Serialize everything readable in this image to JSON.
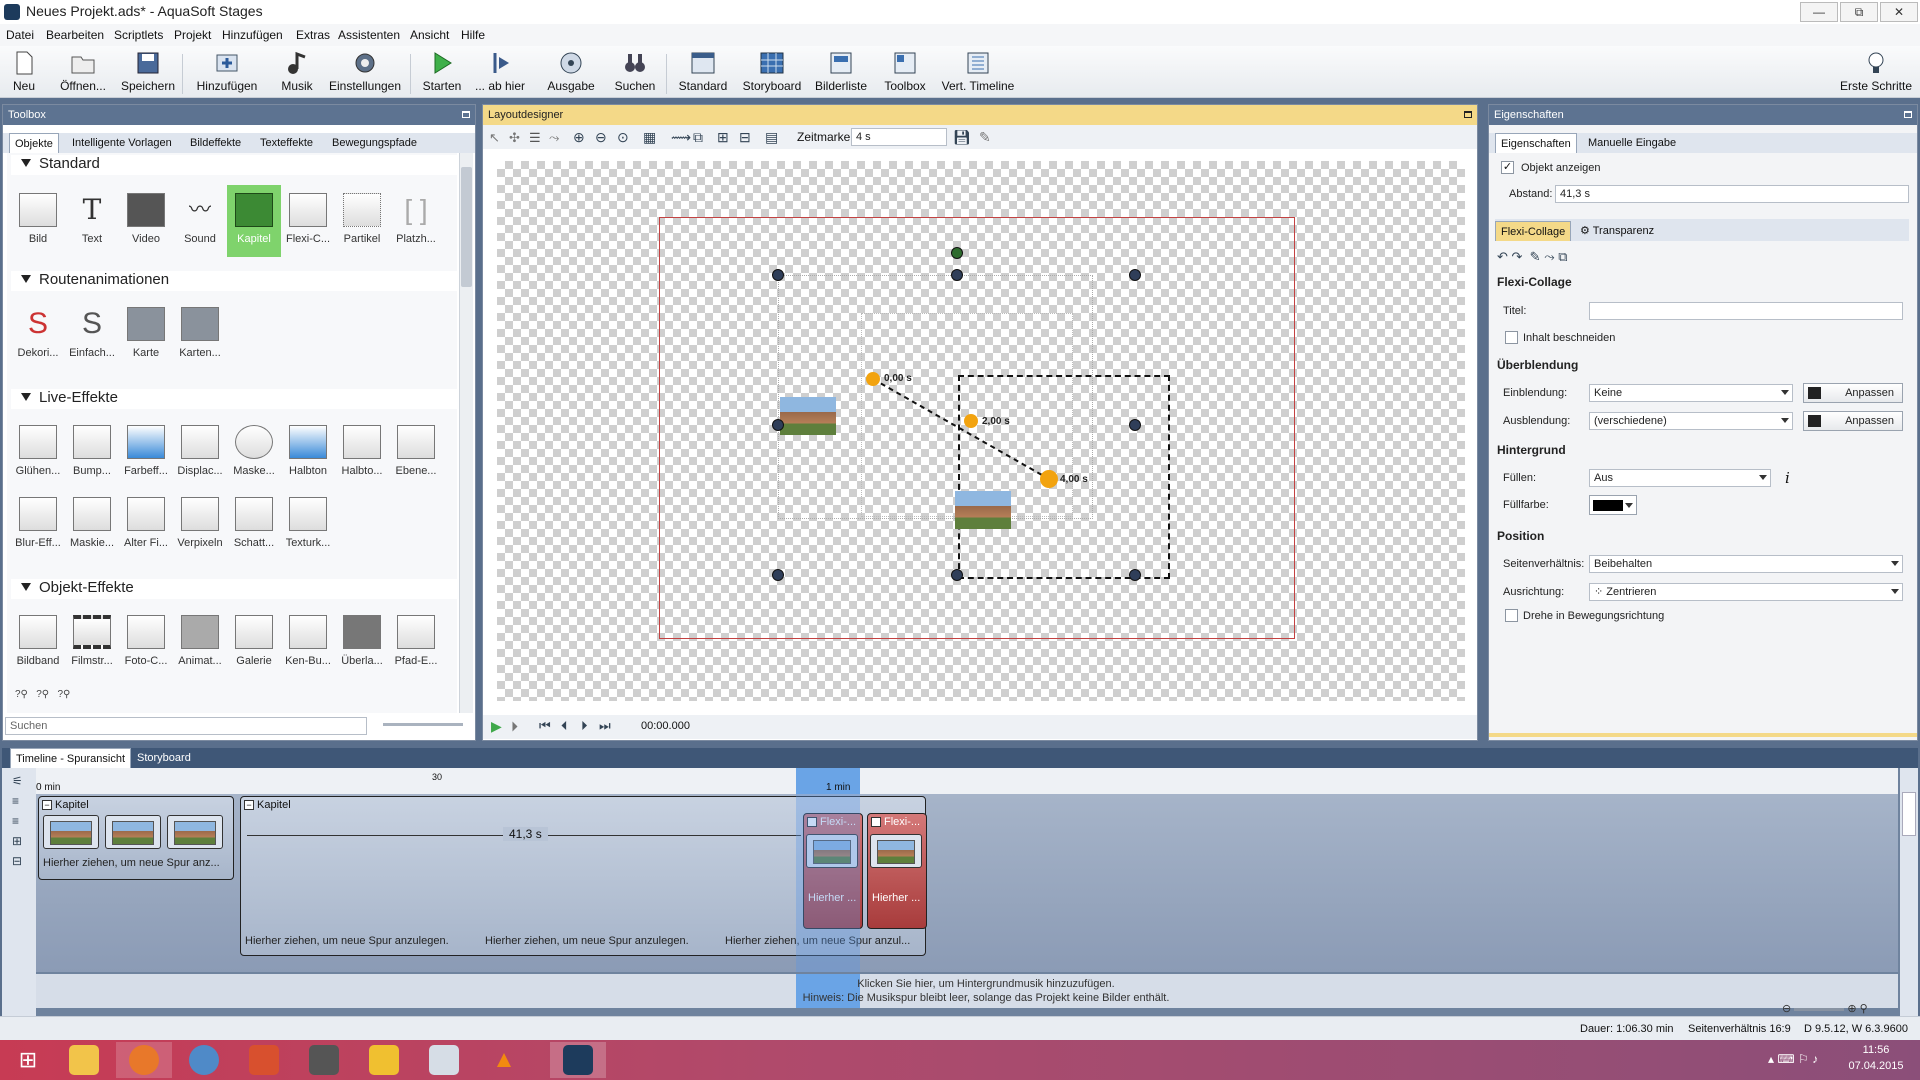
{
  "window": {
    "title": "Neues Projekt.ads* - AquaSoft Stages",
    "min": "—",
    "max": "⧉",
    "close": "✕"
  },
  "menu": [
    "Datei",
    "Bearbeiten",
    "Scriptlets",
    "Projekt",
    "Hinzufügen",
    "Extras",
    "Assistenten",
    "Ansicht",
    "Hilfe"
  ],
  "toolbar": {
    "neu": "Neu",
    "oeffnen": "Öffnen...",
    "speichern": "Speichern",
    "hinzufuegen": "Hinzufügen",
    "musik": "Musik",
    "einstellungen": "Einstellungen",
    "starten": "Starten",
    "abhier": "... ab hier",
    "ausgabe": "Ausgabe",
    "suchen": "Suchen",
    "standard": "Standard",
    "storyboard": "Storyboard",
    "bilderliste": "Bilderliste",
    "toolbox": "Toolbox",
    "verttimeline": "Vert. Timeline",
    "ersteschritte": "Erste Schritte"
  },
  "toolbox": {
    "title": "Toolbox",
    "tabs": [
      "Objekte",
      "Intelligente Vorlagen",
      "Bildeffekte",
      "Texteffekte",
      "Bewegungspfade"
    ],
    "sections": {
      "standard": "Standard",
      "routen": "Routenanimationen",
      "live": "Live-Effekte",
      "objekt": "Objekt-Effekte"
    },
    "standard_items": [
      "Bild",
      "Text",
      "Video",
      "Sound",
      "Kapitel",
      "Flexi-C...",
      "Partikel",
      "Platzh..."
    ],
    "routen_items": [
      "Dekori...",
      "Einfach...",
      "Karte",
      "Karten..."
    ],
    "live_items_row1": [
      "Glühen...",
      "Bump...",
      "Farbeff...",
      "Displac...",
      "Maske...",
      "Halbton",
      "Halbto...",
      "Ebene..."
    ],
    "live_items_row2": [
      "Blur-Eff...",
      "Maskie...",
      "Alter Fi...",
      "Verpixeln",
      "Schatt...",
      "Texturk..."
    ],
    "objekt_items": [
      "Bildband",
      "Filmstr...",
      "Foto-C...",
      "Animat...",
      "Galerie",
      "Ken-Bu...",
      "Überla...",
      "Pfad-E..."
    ],
    "search_placeholder": "Suchen"
  },
  "layout": {
    "title": "Layoutdesigner",
    "zeitmarke_label": "Zeitmarke:",
    "zeitmarke_value": "4 s",
    "keyframes": [
      "0,00 s",
      "2,00 s",
      "4,00 s"
    ],
    "playtime": "00:00.000"
  },
  "props": {
    "title": "Eigenschaften",
    "tabs": [
      "Eigenschaften",
      "Manuelle Eingabe"
    ],
    "objekt_anzeigen": "Objekt anzeigen",
    "abstand_label": "Abstand:",
    "abstand_value": "41,3 s",
    "subtabs": [
      "Flexi-Collage",
      "Transparenz"
    ],
    "flexi_header": "Flexi-Collage",
    "titel_label": "Titel:",
    "titel_value": "",
    "inhalt_beschneiden": "Inhalt beschneiden",
    "ueberblendung": "Überblendung",
    "einblendung_label": "Einblendung:",
    "einblendung_value": "Keine",
    "ausblendung_label": "Ausblendung:",
    "ausblendung_value": "(verschiedene)",
    "anpassen": "Anpassen",
    "hintergrund": "Hintergrund",
    "fuellen_label": "Füllen:",
    "fuellen_value": "Aus",
    "fuellfarbe_label": "Füllfarbe:",
    "fuellfarbe_color": "#000000",
    "position": "Position",
    "seitenverhaeltnis_label": "Seitenverhältnis:",
    "seitenverhaeltnis_value": "Beibehalten",
    "ausrichtung_label": "Ausrichtung:",
    "ausrichtung_value": "Zentrieren",
    "drehe": "Drehe in Bewegungsrichtung"
  },
  "timeline": {
    "tabs": [
      "Timeline - Spuransicht",
      "Storyboard"
    ],
    "ruler_start": "0 min",
    "ruler_30": "30",
    "ruler_1min": "1 min",
    "kapitel1": "Kapitel",
    "kapitel2": "Kapitel",
    "drop_hint1": "Hierher ziehen, um neue Spur anz...",
    "duration": "41,3 s",
    "flexi1": "Flexi-...",
    "flexi2": "Flexi-...",
    "hier1": "Hierher ...",
    "hier2": "Hierher ...",
    "drop_hint_a": "Hierher ziehen, um neue Spur anzulegen.",
    "drop_hint_b": "Hierher ziehen, um neue Spur anzulegen.",
    "drop_hint_c": "Hierher ziehen, um neue Spur anzul...",
    "music_line1": "Klicken Sie hier, um Hintergrundmusik hinzuzufügen.",
    "music_line2": "Hinweis: Die Musikspur bleibt leer, solange das Projekt keine Bilder enthält."
  },
  "status": {
    "dauer": "Dauer: 1:06.30 min",
    "ratio": "Seitenverhältnis 16:9",
    "version": "D 9.5.12, W 6.3.9600"
  },
  "taskbar": {
    "time": "11:56",
    "date": "07.04.2015"
  }
}
